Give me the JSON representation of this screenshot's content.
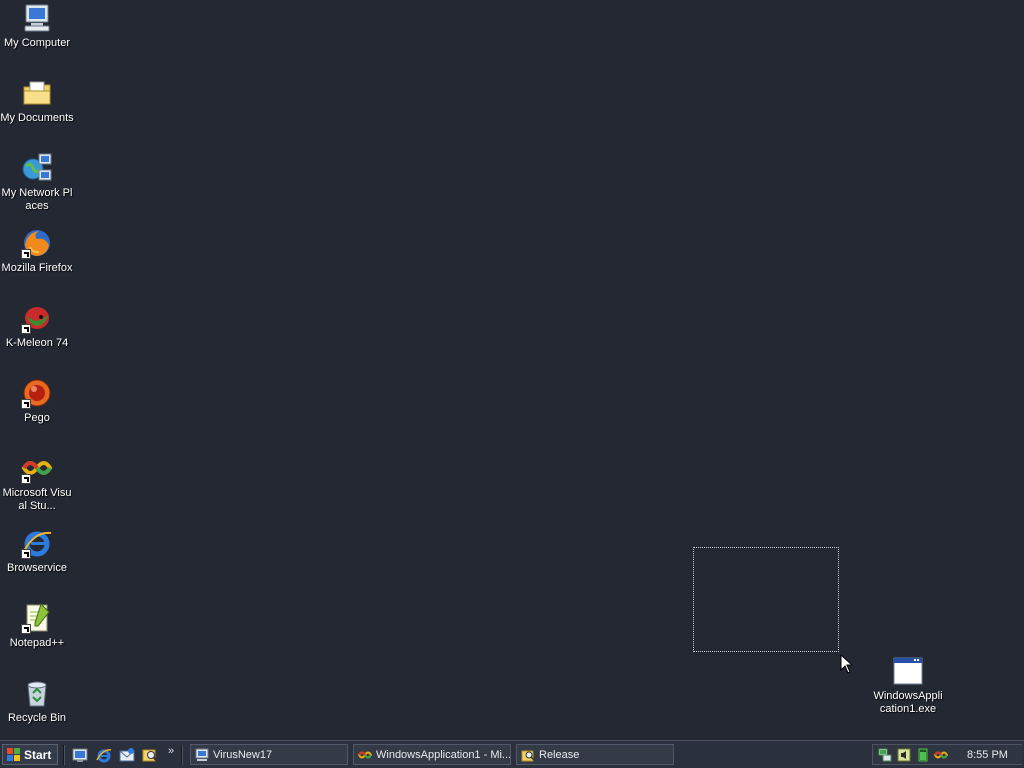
{
  "desktop": {
    "icons": [
      {
        "label": "My Computer",
        "icon": "my-computer-icon"
      },
      {
        "label": "My Documents",
        "icon": "my-documents-icon"
      },
      {
        "label": "My Network Places",
        "icon": "network-places-icon"
      },
      {
        "label": "Mozilla Firefox",
        "icon": "firefox-icon"
      },
      {
        "label": "K-Meleon 74",
        "icon": "k-meleon-icon"
      },
      {
        "label": "Pego",
        "icon": "pego-icon"
      },
      {
        "label": "Microsoft Visual Stu...",
        "icon": "visual-studio-icon"
      },
      {
        "label": "Browservice",
        "icon": "internet-explorer-icon"
      },
      {
        "label": "Notepad++",
        "icon": "notepad-plus-plus-icon"
      },
      {
        "label": "Recycle Bin",
        "icon": "recycle-bin-icon"
      }
    ],
    "file_icon": {
      "label": "WindowsApplication1.exe",
      "icon": "exe-window-icon"
    }
  },
  "taskbar": {
    "start_label": "Start",
    "quick_launch": [
      "show-desktop-icon",
      "internet-explorer-icon",
      "outlook-icon",
      "search-icon"
    ],
    "quick_launch_more": "»",
    "tasks": [
      {
        "label": "VirusNew17",
        "icon": "computer-icon"
      },
      {
        "label": "WindowsApplication1 - Mi...",
        "icon": "visual-studio-icon"
      },
      {
        "label": "Release",
        "icon": "folder-search-icon"
      }
    ],
    "tray_icons": [
      "network-icon",
      "speaker-icon",
      "battery-icon",
      "visual-studio-tray-icon"
    ],
    "clock": "8:55 PM"
  },
  "colors": {
    "desktop_bg": "#232833",
    "taskbar_bg": "#2b313c"
  }
}
